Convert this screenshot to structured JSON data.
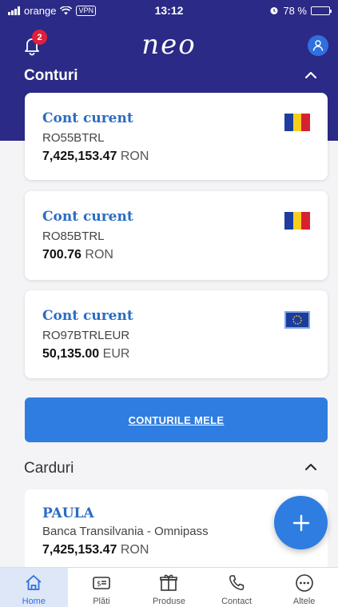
{
  "status_bar": {
    "carrier": "orange",
    "vpn": "VPN",
    "time": "13:12",
    "battery": "78 %",
    "battery_level": 0.78
  },
  "header": {
    "notifications_count": "2",
    "logo": "neo",
    "section_title": "Conturi"
  },
  "accounts": [
    {
      "name": "Cont curent",
      "iban": "RO55BTRL",
      "amount": "7,425,153.47",
      "currency": "RON",
      "flag": "romania-flag-icon"
    },
    {
      "name": "Cont curent",
      "iban": "RO85BTRL",
      "amount": "700.76",
      "currency": "RON",
      "flag": "romania-flag-icon"
    },
    {
      "name": "Cont curent",
      "iban": "RO97BTRLEUR",
      "amount": "50,135.00",
      "currency": "EUR",
      "flag": "eu-flag-icon"
    }
  ],
  "my_accounts_button": "CONTURILE MELE",
  "cards_section": {
    "title": "Carduri",
    "card": {
      "holder": "PAULA",
      "product": "Banca Transilvania - Omnipass",
      "amount": "7,425,153.47",
      "currency": "RON"
    }
  },
  "tabbar": [
    {
      "label": "Home",
      "icon": "home-icon",
      "active": true
    },
    {
      "label": "Plăti",
      "icon": "payments-icon",
      "active": false
    },
    {
      "label": "Produse",
      "icon": "products-icon",
      "active": false
    },
    {
      "label": "Contact",
      "icon": "phone-icon",
      "active": false
    },
    {
      "label": "Altele",
      "icon": "more-icon",
      "active": false
    }
  ],
  "colors": {
    "brand_navy": "#2b2a86",
    "accent_blue": "#2f7de0",
    "link_blue": "#2a6cc2",
    "badge_red": "#e0203a"
  }
}
